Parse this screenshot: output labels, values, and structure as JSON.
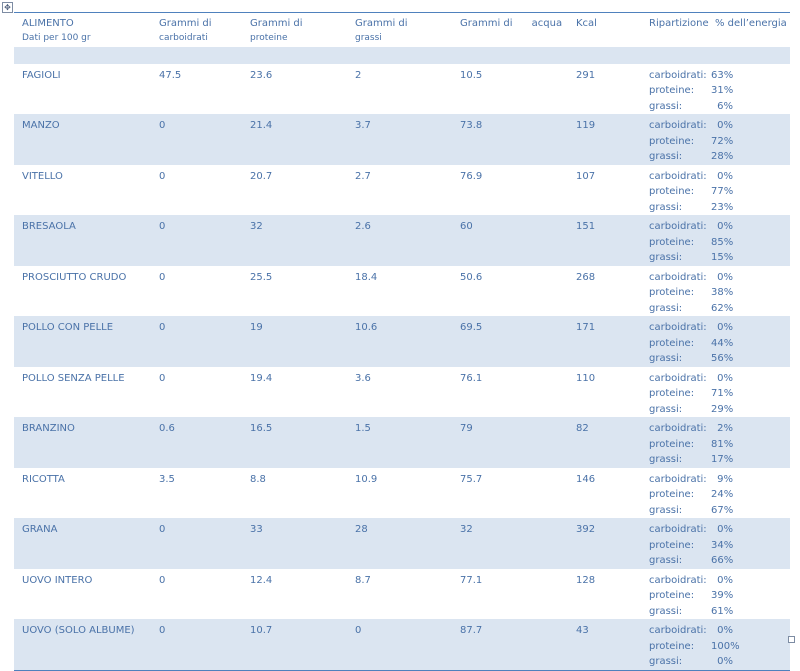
{
  "header": {
    "alimento": "ALIMENTO",
    "alimento_sub": "Dati per 100 gr",
    "carboidrati_line1": "Grammi di",
    "carboidrati_line2": "carboidrati",
    "proteine_line1": "Grammi di",
    "proteine_line2": "proteine",
    "grassi_line1": "Grammi di",
    "grassi_line2": "grassi",
    "acqua": "Grammi di      acqua",
    "kcal": "Kcal",
    "ripartizione": "Ripartizione  % dell’energia"
  },
  "labels": {
    "carboidrati": "carboidrati:",
    "proteine": "proteine:",
    "grassi": "grassi:"
  },
  "rows": [
    {
      "alimento": "FAGIOLI",
      "carboidrati": "47.5",
      "proteine": "23.6",
      "grassi": "2",
      "acqua": "10.5",
      "kcal": "291",
      "pct_carboidrati": "63%",
      "pct_proteine": "31%",
      "pct_grassi": "6%"
    },
    {
      "alimento": "MANZO",
      "carboidrati": "0",
      "proteine": "21.4",
      "grassi": "3.7",
      "acqua": "73.8",
      "kcal": "119",
      "pct_carboidrati": "0%",
      "pct_proteine": "72%",
      "pct_grassi": "28%"
    },
    {
      "alimento": "VITELLO",
      "carboidrati": "0",
      "proteine": "20.7",
      "grassi": "2.7",
      "acqua": "76.9",
      "kcal": "107",
      "pct_carboidrati": "0%",
      "pct_proteine": "77%",
      "pct_grassi": "23%"
    },
    {
      "alimento": "BRESAOLA",
      "carboidrati": "0",
      "proteine": "32",
      "grassi": "2.6",
      "acqua": "60",
      "kcal": "151",
      "pct_carboidrati": "0%",
      "pct_proteine": "85%",
      "pct_grassi": "15%"
    },
    {
      "alimento": "PROSCIUTTO  CRUDO",
      "carboidrati": "0",
      "proteine": "25.5",
      "grassi": "18.4",
      "acqua": "50.6",
      "kcal": "268",
      "pct_carboidrati": "0%",
      "pct_proteine": "38%",
      "pct_grassi": "62%"
    },
    {
      "alimento": "POLLO CON PELLE",
      "carboidrati": "0",
      "proteine": "19",
      "grassi": "10.6",
      "acqua": "69.5",
      "kcal": "171",
      "pct_carboidrati": "0%",
      "pct_proteine": "44%",
      "pct_grassi": "56%"
    },
    {
      "alimento": "POLLO SENZA PELLE",
      "carboidrati": "0",
      "proteine": "19.4",
      "grassi": "3.6",
      "acqua": "76.1",
      "kcal": "110",
      "pct_carboidrati": "0%",
      "pct_proteine": "71%",
      "pct_grassi": "29%"
    },
    {
      "alimento": "BRANZINO",
      "carboidrati": "0.6",
      "proteine": "16.5",
      "grassi": "1.5",
      "acqua": "79",
      "kcal": "82",
      "pct_carboidrati": "2%",
      "pct_proteine": "81%",
      "pct_grassi": "17%"
    },
    {
      "alimento": "RICOTTA",
      "carboidrati": "3.5",
      "proteine": "8.8",
      "grassi": "10.9",
      "acqua": "75.7",
      "kcal": "146",
      "pct_carboidrati": "9%",
      "pct_proteine": "24%",
      "pct_grassi": "67%"
    },
    {
      "alimento": "GRANA",
      "carboidrati": "0",
      "proteine": "33",
      "grassi": "28",
      "acqua": "32",
      "kcal": "392",
      "pct_carboidrati": "0%",
      "pct_proteine": "34%",
      "pct_grassi": "66%"
    },
    {
      "alimento": "UOVO  INTERO",
      "carboidrati": "0",
      "proteine": "12.4",
      "grassi": "8.7",
      "acqua": "77.1",
      "kcal": "128",
      "pct_carboidrati": "0%",
      "pct_proteine": "39%",
      "pct_grassi": "61%"
    },
    {
      "alimento": "UOVO  (SOLO ALBUME)",
      "carboidrati": "0",
      "proteine": "10.7",
      "grassi": "0",
      "acqua": "87.7",
      "kcal": "43",
      "pct_carboidrati": "0%",
      "pct_proteine": "100%",
      "pct_grassi": "0%"
    }
  ],
  "colors": {
    "text": "#4a72a8",
    "band": "#dbe5f1",
    "rule": "#4f81bd"
  },
  "icons": {
    "move": "move-handle-icon",
    "resize": "resize-handle-icon"
  }
}
